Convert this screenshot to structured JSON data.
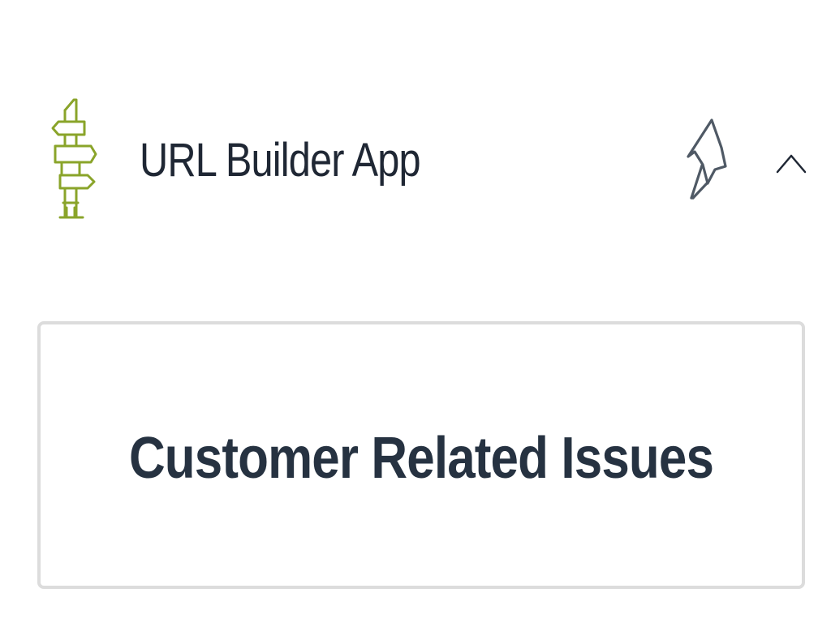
{
  "header": {
    "title": "URL Builder App",
    "icon": "signpost-icon",
    "icon_color": "#8aa42a",
    "pin_icon": "pin-icon",
    "collapse_icon": "chevron-up-icon"
  },
  "card": {
    "title": "Customer Related Issues"
  },
  "colors": {
    "text": "#1f2734",
    "card_border": "#dcdcdc",
    "icon_gray": "#4f5965"
  }
}
